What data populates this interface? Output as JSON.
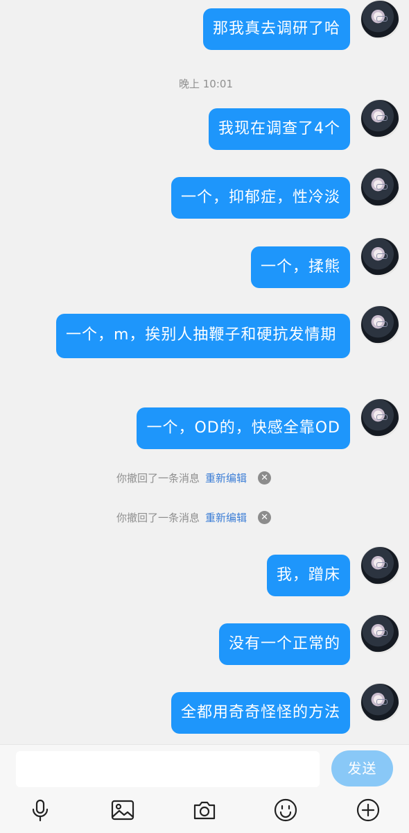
{
  "messages": [
    {
      "text": "那我真去调研了哈"
    },
    {
      "text": "我现在调查了4个"
    },
    {
      "text": "一个，抑郁症，性冷淡"
    },
    {
      "text": "一个，揉熊"
    },
    {
      "text": "一个，m，挨别人抽鞭子和硬抗发情期"
    },
    {
      "text": "一个，OD的，快感全靠OD"
    },
    {
      "text": "我，蹭床"
    },
    {
      "text": "没有一个正常的"
    },
    {
      "text": "全都用奇奇怪怪的方法"
    }
  ],
  "timestamp": "晚上 10:01",
  "recall_notices": [
    {
      "text": "你撤回了一条消息",
      "action": "重新编辑"
    },
    {
      "text": "你撤回了一条消息",
      "action": "重新编辑"
    }
  ],
  "input": {
    "value": "",
    "send_label": "发送"
  },
  "toolbar": [
    "microphone-icon",
    "image-icon",
    "camera-icon",
    "emoji-icon",
    "plus-icon"
  ],
  "colors": {
    "bubble": "#1e96fb",
    "send_button": "#89c8f7",
    "background": "#f1f1f1",
    "link": "#3c7ed6"
  }
}
